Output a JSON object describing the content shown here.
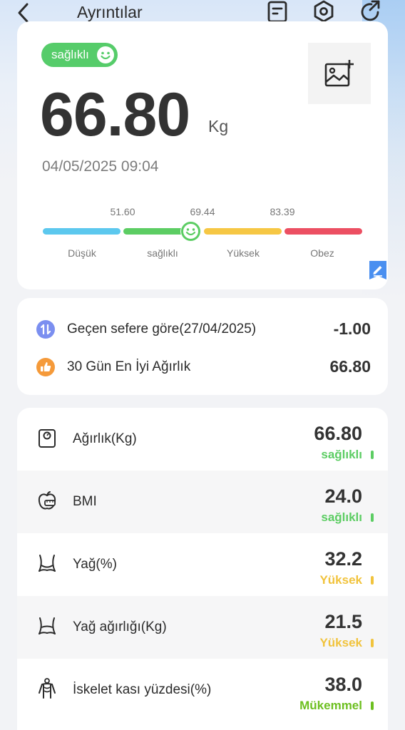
{
  "header": {
    "title": "Ayrıntılar"
  },
  "main": {
    "status_badge": "sağlıklı",
    "weight": "66.80",
    "unit": "Kg",
    "datetime": "04/05/2025 09:04",
    "scale": {
      "ticks": [
        "51.60",
        "69.44",
        "83.39"
      ],
      "segments": [
        {
          "label": "Düşük",
          "color": "#5cc8ee"
        },
        {
          "label": "sağlıklı",
          "color": "#5ccd63"
        },
        {
          "label": "Yüksek",
          "color": "#f6c744"
        },
        {
          "label": "Obez",
          "color": "#ec4f62"
        }
      ]
    }
  },
  "compare": {
    "previous": {
      "label": "Geçen sefere göre(27/04/2025)",
      "value": "-1.00",
      "icon": "compare-icon",
      "color": "#7b8ff0"
    },
    "best": {
      "label": "30 Gün En İyi Ağırlık",
      "value": "66.80",
      "icon": "thumb-up-icon",
      "color": "#f59a3a"
    }
  },
  "metrics": [
    {
      "label": "Ağırlık(Kg)",
      "value": "66.80",
      "status": "sağlıklı",
      "color": "#5ccd63",
      "icon": "scale-icon"
    },
    {
      "label": "BMI",
      "value": "24.0",
      "status": "sağlıklı",
      "color": "#5ccd63",
      "icon": "bmi-icon"
    },
    {
      "label": "Yağ(%)",
      "value": "32.2",
      "status": "Yüksek",
      "color": "#f1c33c",
      "icon": "body-fat-icon"
    },
    {
      "label": "Yağ ağırlığı(Kg)",
      "value": "21.5",
      "status": "Yüksek",
      "color": "#f1c33c",
      "icon": "fat-weight-icon"
    },
    {
      "label": "İskelet kası yüzdesi(%)",
      "value": "38.0",
      "status": "Mükemmel",
      "color": "#6cbf1f",
      "icon": "muscle-icon"
    }
  ]
}
